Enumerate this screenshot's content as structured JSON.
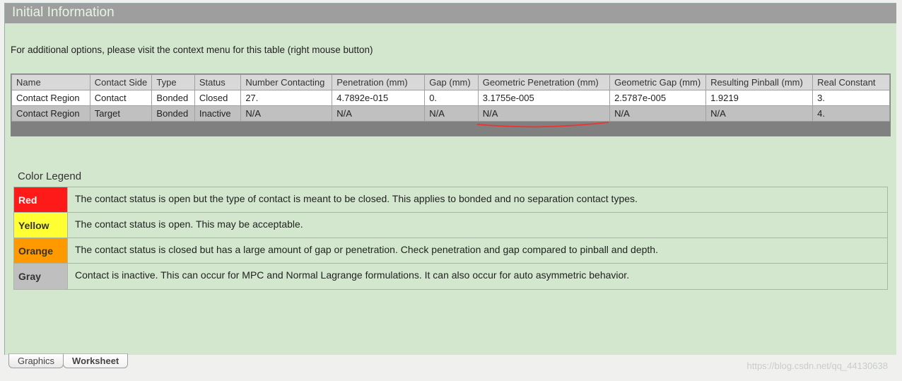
{
  "header": {
    "title": "Initial Information"
  },
  "hint": "For additional options, please visit the context menu for this table (right mouse button)",
  "table": {
    "columns": [
      "Name",
      "Contact Side",
      "Type",
      "Status",
      "Number Contacting",
      "Penetration (mm)",
      "Gap (mm)",
      "Geometric Penetration (mm)",
      "Geometric Gap (mm)",
      "Resulting Pinball (mm)",
      "Real Constant"
    ],
    "rows": [
      {
        "style": "white",
        "name": "Contact Region",
        "side": "Contact",
        "type": "Bonded",
        "status": "Closed",
        "num": "27.",
        "pen": "4.7892e-015",
        "gap": "0.",
        "gpen": "3.1755e-005",
        "ggap": "2.5787e-005",
        "pin": "1.9219",
        "real": "3."
      },
      {
        "style": "gray",
        "name": "Contact Region",
        "side": "Target",
        "type": "Bonded",
        "status": "Inactive",
        "num": "N/A",
        "pen": "N/A",
        "gap": "N/A",
        "gpen": "N/A",
        "ggap": "N/A",
        "pin": "N/A",
        "real": "4."
      }
    ]
  },
  "legend": {
    "title": "Color Legend",
    "items": [
      {
        "label": "Red",
        "swatch": "sw-red",
        "text": "The contact status is open but the type of contact is meant to be closed. This applies to bonded and no separation contact types."
      },
      {
        "label": "Yellow",
        "swatch": "sw-yellow",
        "text": "The contact status is open. This may be acceptable."
      },
      {
        "label": "Orange",
        "swatch": "sw-orange",
        "text": "The contact status is closed but has a large amount of gap or penetration. Check penetration and gap compared to pinball and depth."
      },
      {
        "label": "Gray",
        "swatch": "sw-gray",
        "text": "Contact is inactive. This can occur for MPC and Normal Lagrange formulations. It can also occur for auto asymmetric behavior."
      }
    ]
  },
  "tabs": {
    "graphics": "Graphics",
    "worksheet": "Worksheet"
  },
  "watermark": "https://blog.csdn.net/qq_44130638"
}
